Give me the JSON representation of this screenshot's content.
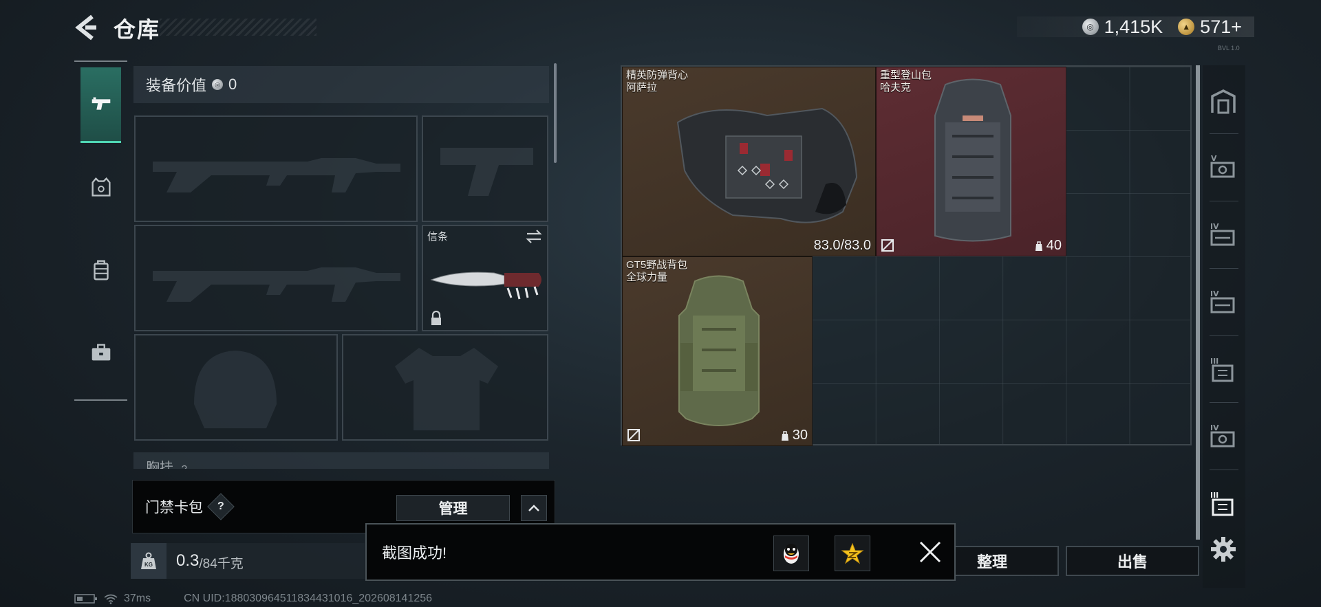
{
  "header": {
    "title": "仓库",
    "back_icon": "back-arrow-icon",
    "currency": [
      {
        "icon": "silver-coin-icon",
        "value": "1,415K"
      },
      {
        "icon": "gold-coin-icon",
        "value": "571+"
      }
    ],
    "version_tag": "BVL 1.0"
  },
  "left_tabs": [
    {
      "name": "weapons",
      "icon": "pistol-icon",
      "active": true
    },
    {
      "name": "armor",
      "icon": "vest-icon",
      "active": false
    },
    {
      "name": "backpacks",
      "icon": "backpack-icon",
      "active": false
    },
    {
      "name": "supplies",
      "icon": "briefcase-icon",
      "active": false
    }
  ],
  "equipment": {
    "value_label": "装备价值",
    "value": "0",
    "melee_label": "信条",
    "next_section_label": "胸挂",
    "next_section_badge": "?"
  },
  "card_bar": {
    "label": "门禁卡包",
    "help": "?",
    "manage_label": "管理"
  },
  "weight": {
    "current": "0.3",
    "rest": "/84千克",
    "icon_text": "KG"
  },
  "stash_items": [
    {
      "name_line1": "精英防弹背心",
      "name_line2": "阿萨拉",
      "durability": "83.0/83.0",
      "rarity_color": "#4a3a2c"
    },
    {
      "name_line1": "重型登山包",
      "name_line2": "哈夫克",
      "capacity": "40",
      "rarity_color": "#5e2d33"
    },
    {
      "name_line1": "GT5野战背包",
      "name_line2": "全球力量",
      "capacity": "30",
      "rarity_color": "#4a3a2c"
    }
  ],
  "right_tabs": [
    {
      "icon": "safe-box-icon"
    },
    {
      "icon": "level-v-case-icon"
    },
    {
      "icon": "level-iv-case-icon"
    },
    {
      "icon": "level-iv-case-icon"
    },
    {
      "icon": "level-iii-case-icon"
    },
    {
      "icon": "level-iv-case-icon"
    },
    {
      "icon": "level-iii-case-active-icon"
    }
  ],
  "buttons": {
    "organize": "整理",
    "sell": "出售"
  },
  "toast": {
    "message": "截图成功!"
  },
  "status": {
    "ping": "37ms",
    "uid": "CN UID:18803096451183443101​6_202608141256"
  }
}
